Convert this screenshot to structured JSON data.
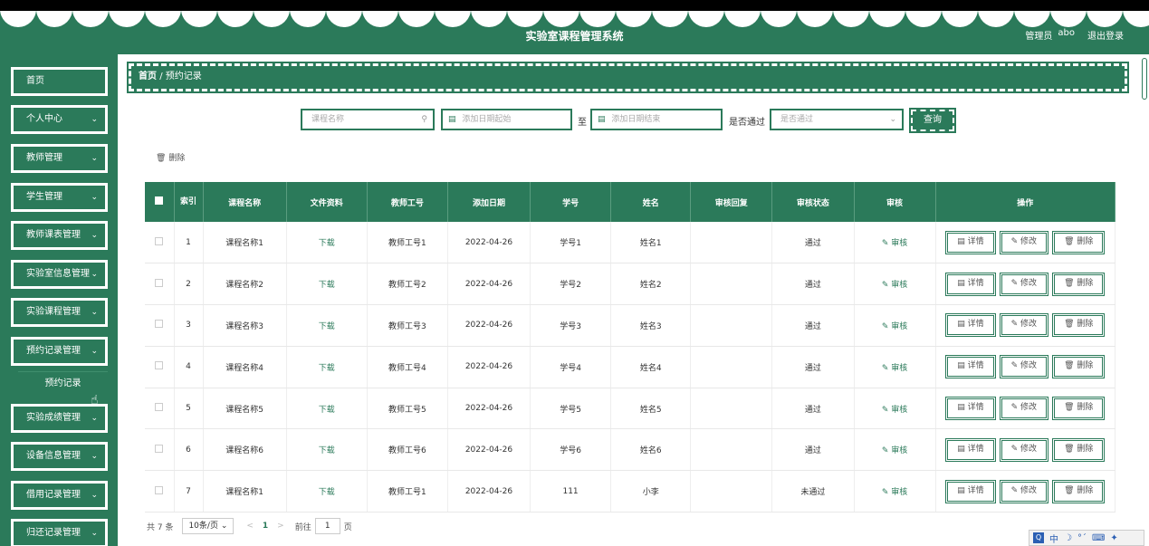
{
  "app": {
    "title": "实验室课程管理系统",
    "role": "管理员",
    "username": "abo",
    "logout": "退出登录"
  },
  "sidebar": {
    "items": [
      {
        "label": "首页",
        "chevron": false
      },
      {
        "label": "个人中心",
        "chevron": true
      },
      {
        "label": "教师管理",
        "chevron": true
      },
      {
        "label": "学生管理",
        "chevron": true
      },
      {
        "label": "教师课表管理",
        "chevron": true
      },
      {
        "label": "实验室信息管理",
        "chevron": true
      },
      {
        "label": "实验课程管理",
        "chevron": true
      },
      {
        "label": "预约记录管理",
        "chevron": true
      },
      {
        "label": "实验成绩管理",
        "chevron": true
      },
      {
        "label": "设备信息管理",
        "chevron": true
      },
      {
        "label": "借用记录管理",
        "chevron": true
      },
      {
        "label": "归还记录管理",
        "chevron": true
      }
    ],
    "sub_item": "预约记录"
  },
  "breadcrumb": {
    "home": "首页",
    "sep": "/",
    "current": "预约记录"
  },
  "search": {
    "course_placeholder": "课程名称",
    "date_start_placeholder": "添加日期起始",
    "date_to": "至",
    "date_end_placeholder": "添加日期结束",
    "approved_label": "是否通过",
    "approved_placeholder": "是否通过",
    "query_button": "查询"
  },
  "toolbar": {
    "delete_label": "删除"
  },
  "table": {
    "headers": [
      "索引",
      "课程名称",
      "文件资料",
      "教师工号",
      "添加日期",
      "学号",
      "姓名",
      "审核回复",
      "审核状态",
      "审核",
      "操作"
    ],
    "rows": [
      {
        "index": "1",
        "course": "课程名称1",
        "file": "下载",
        "teacher_id": "教师工号1",
        "date": "2022-04-26",
        "student_id": "学号1",
        "name": "姓名1",
        "reply": "",
        "status": "通过",
        "audit": "审核"
      },
      {
        "index": "2",
        "course": "课程名称2",
        "file": "下载",
        "teacher_id": "教师工号2",
        "date": "2022-04-26",
        "student_id": "学号2",
        "name": "姓名2",
        "reply": "",
        "status": "通过",
        "audit": "审核"
      },
      {
        "index": "3",
        "course": "课程名称3",
        "file": "下载",
        "teacher_id": "教师工号3",
        "date": "2022-04-26",
        "student_id": "学号3",
        "name": "姓名3",
        "reply": "",
        "status": "通过",
        "audit": "审核"
      },
      {
        "index": "4",
        "course": "课程名称4",
        "file": "下载",
        "teacher_id": "教师工号4",
        "date": "2022-04-26",
        "student_id": "学号4",
        "name": "姓名4",
        "reply": "",
        "status": "通过",
        "audit": "审核"
      },
      {
        "index": "5",
        "course": "课程名称5",
        "file": "下载",
        "teacher_id": "教师工号5",
        "date": "2022-04-26",
        "student_id": "学号5",
        "name": "姓名5",
        "reply": "",
        "status": "通过",
        "audit": "审核"
      },
      {
        "index": "6",
        "course": "课程名称6",
        "file": "下载",
        "teacher_id": "教师工号6",
        "date": "2022-04-26",
        "student_id": "学号6",
        "name": "姓名6",
        "reply": "",
        "status": "通过",
        "audit": "审核"
      },
      {
        "index": "7",
        "course": "课程名称1",
        "file": "下载",
        "teacher_id": "教师工号1",
        "date": "2022-04-26",
        "student_id": "111",
        "name": "小李",
        "reply": "",
        "status": "未通过",
        "audit": "审核"
      }
    ],
    "actions": {
      "detail": "详情",
      "edit": "修改",
      "delete": "删除"
    }
  },
  "pager": {
    "total": "共 7 条",
    "page_size": "10条/页",
    "current_page": "1",
    "goto_label": "前往",
    "goto_value": "1",
    "page_unit": "页"
  },
  "ime": {
    "text": "中"
  },
  "colors": {
    "primary": "#2b7a5a",
    "text": "#333333"
  }
}
